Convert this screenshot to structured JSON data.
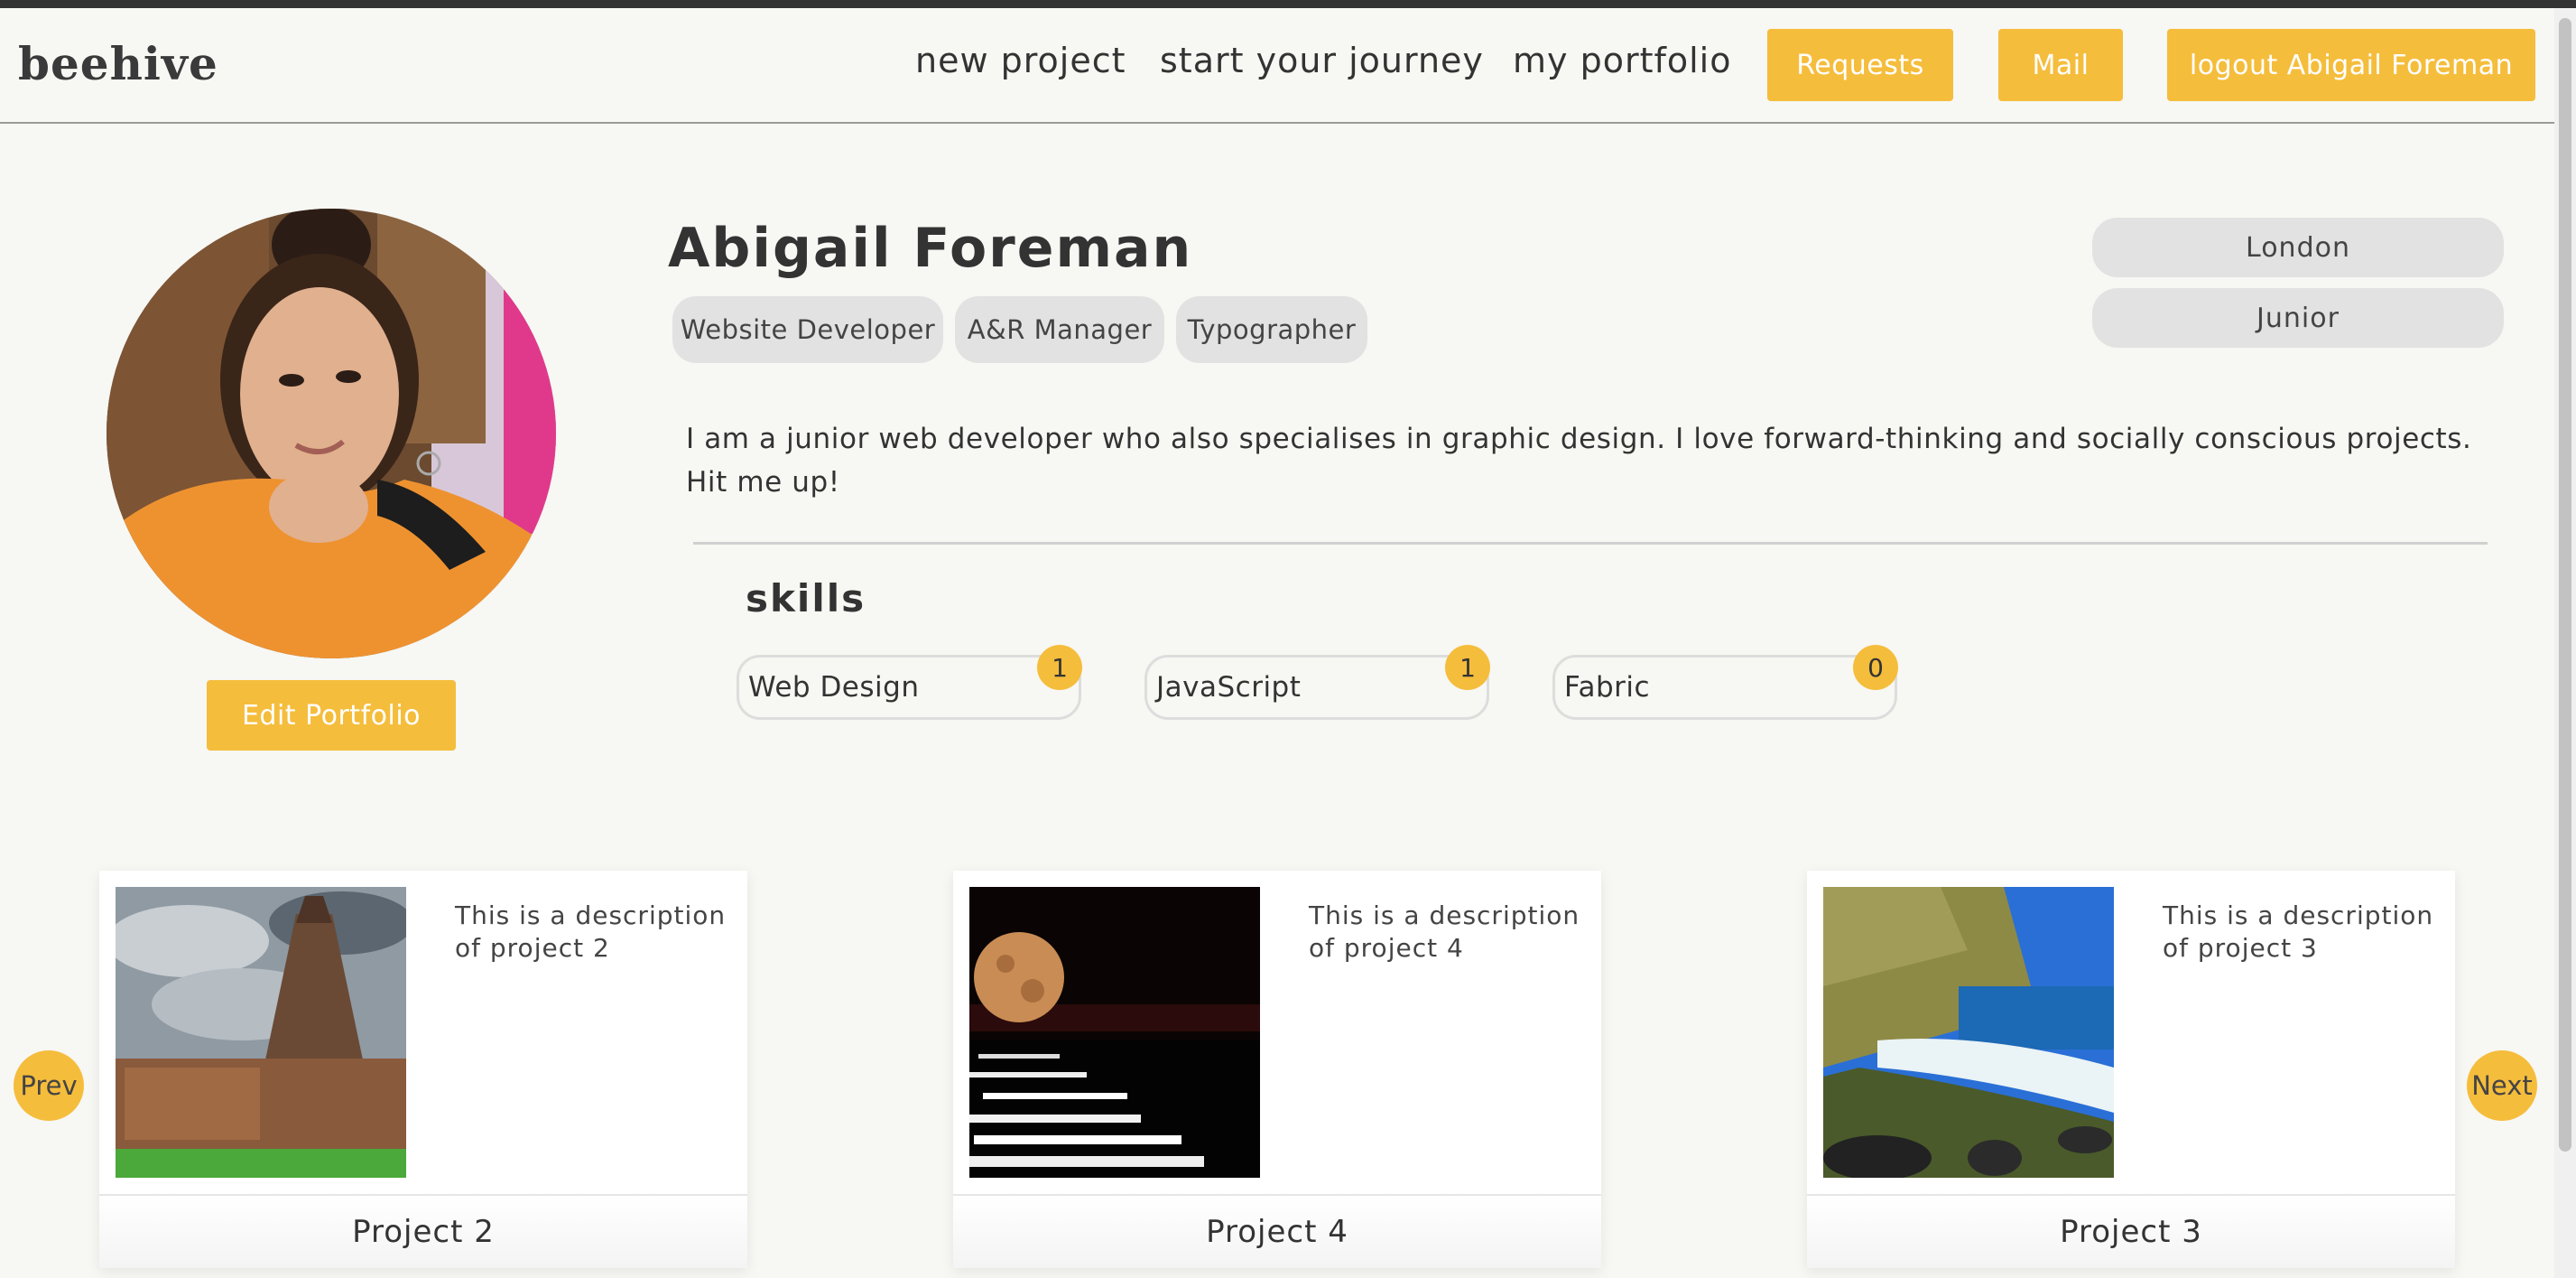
{
  "navbar": {
    "logo": "beehive",
    "links": [
      "new project",
      "start your journey",
      "my portfolio"
    ],
    "buttons": [
      "Requests",
      "Mail",
      "logout Abigail Foreman"
    ]
  },
  "profile": {
    "name": "Abigail Foreman",
    "roles": [
      "Website Developer",
      "A&R Manager",
      "Typographer"
    ],
    "location": "London",
    "level": "Junior",
    "bio": "I am a junior web developer who also specialises in graphic design. I love forward-thinking and socially conscious projects. Hit me up!",
    "edit_label": "Edit Portfolio"
  },
  "skills": {
    "heading": "skills",
    "items": [
      {
        "name": "Web Design",
        "count": "1"
      },
      {
        "name": "JavaScript",
        "count": "1"
      },
      {
        "name": "Fabric",
        "count": "0"
      }
    ]
  },
  "projects": {
    "prev_label": "Prev",
    "next_label": "Next",
    "cards": [
      {
        "title": "Project 2",
        "description": "This is a description of project 2",
        "image": "temple-photo"
      },
      {
        "title": "Project 4",
        "description": "This is a description of project 4",
        "image": "moon-over-sea-photo"
      },
      {
        "title": "Project 3",
        "description": "This is a description of project 3",
        "image": "beach-cliff-photo"
      }
    ]
  },
  "colors": {
    "accent": "#f5bd3c",
    "background": "#f7f7f3",
    "pill": "#e2e2e2"
  }
}
